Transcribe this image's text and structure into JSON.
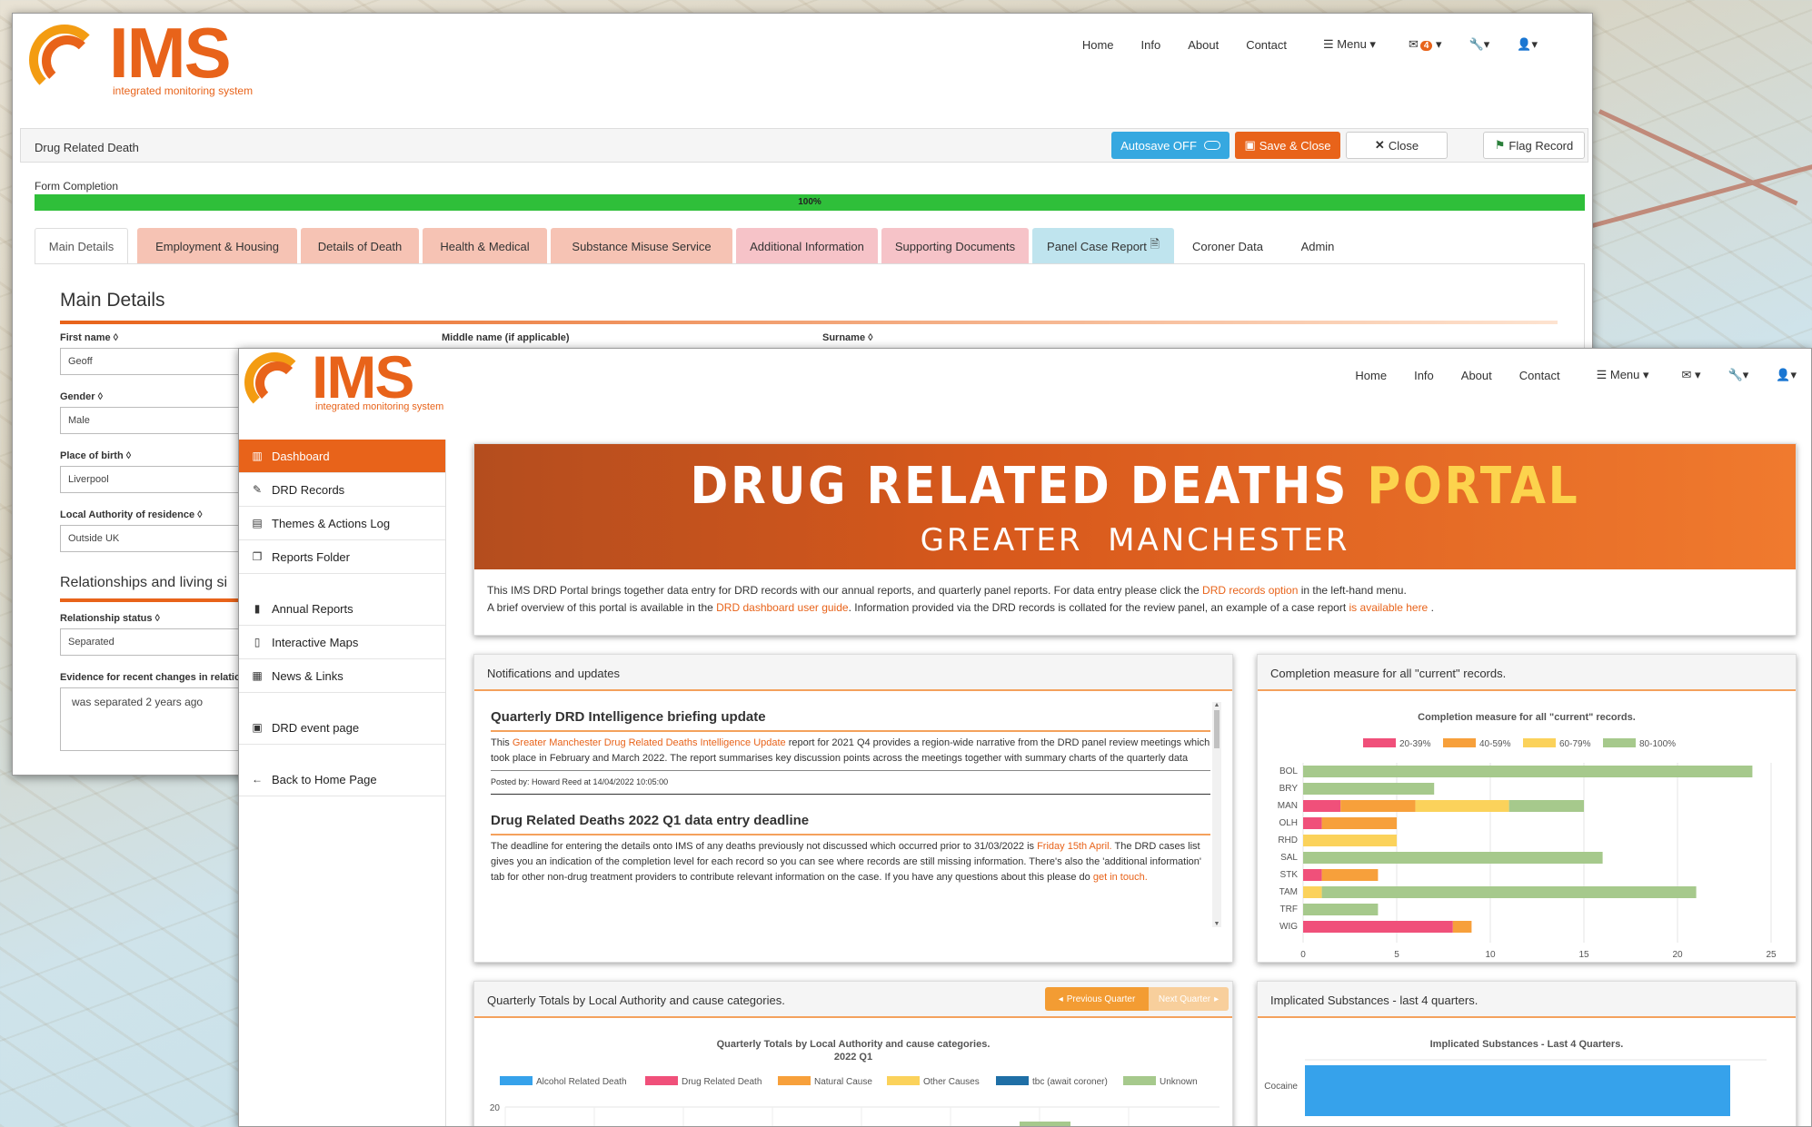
{
  "back_window": {
    "logo": {
      "title": "IMS",
      "subtitle": "integrated monitoring system"
    },
    "nav": [
      "Home",
      "Info",
      "About",
      "Contact",
      "Menu"
    ],
    "mail_count": "4",
    "form_title": "Drug Related Death",
    "autosave_label": "Autosave OFF",
    "save_label": "Save & Close",
    "close_label": "Close",
    "flag_label": "Flag Record",
    "completion_label": "Form Completion",
    "completion_value": "100%",
    "completion_percent": 100,
    "tabs": [
      "Main Details",
      "Employment & Housing",
      "Details of Death",
      "Health & Medical",
      "Substance Misuse Service",
      "Additional Information",
      "Supporting Documents",
      "Panel Case Report",
      "Coroner Data",
      "Admin"
    ],
    "section_title": "Main Details",
    "section2_title": "Relationships and living si",
    "fields": {
      "first_name_label": "First name ◊",
      "first_name": "Geoff",
      "middle_name_label": "Middle name (if applicable)",
      "surname_label": "Surname ◊",
      "gender_label": "Gender ◊",
      "gender": "Male",
      "pob_label": "Place of birth ◊",
      "pob": "Liverpool",
      "la_label": "Local Authority of residence ◊",
      "la": "Outside UK",
      "rel_label": "Relationship status ◊",
      "rel": "Separated",
      "evidence_label": "Evidence for recent changes in relatio",
      "evidence": "was separated 2 years ago"
    }
  },
  "front_window": {
    "logo": {
      "title": "IMS",
      "subtitle": "integrated monitoring system"
    },
    "nav": [
      "Home",
      "Info",
      "About",
      "Contact",
      "Menu"
    ],
    "sidebar": [
      {
        "label": "Dashboard",
        "icon": "chart-icon",
        "active": true
      },
      {
        "label": "DRD Records",
        "icon": "edit-icon"
      },
      {
        "label": "Themes & Actions Log",
        "icon": "clipboard-icon"
      },
      {
        "label": "Reports Folder",
        "icon": "copy-icon"
      },
      {
        "label": "Annual Reports",
        "icon": "book-icon"
      },
      {
        "label": "Interactive Maps",
        "icon": "map-icon"
      },
      {
        "label": "News & Links",
        "icon": "newspaper-icon"
      },
      {
        "label": "DRD event page",
        "icon": "calendar-icon"
      },
      {
        "label": "Back to Home Page",
        "icon": "arrow-left-icon"
      }
    ],
    "banner": {
      "title_white": "DRUG RELATED DEATHS",
      "title_yellow": "PORTAL",
      "subtitle": "GREATER  MANCHESTER"
    },
    "intro": {
      "l1a": "This IMS DRD Portal brings together data entry for DRD records with our annual reports, and quarterly panel reports. For data entry please click the ",
      "l1link": "DRD records option",
      "l1b": " in the left-hand menu.",
      "l2a": "A brief overview of this portal is available in the ",
      "l2link": "DRD dashboard user guide",
      "l2b": ". Information provided via the DRD records is collated for the review panel, an example of a case report ",
      "l2link2": "is available here",
      "l2c": " ."
    },
    "notifications": {
      "header": "Notifications and updates",
      "items": [
        {
          "title": "Quarterly DRD Intelligence briefing update",
          "a": "This ",
          "link": "Greater Manchester Drug Related Deaths Intelligence Update",
          "b": " report for 2021 Q4 provides a region-wide narrative from the DRD panel review meetings which took place in February and March 2022. The report summarises key discussion points across the meetings together with summary charts of the quarterly data",
          "posted": "Posted by: Howard Reed at 14/04/2022 10:05:00"
        },
        {
          "title": "Drug Related Deaths 2022 Q1 data entry deadline",
          "a": "The deadline for entering the details onto IMS of any deaths previously not discussed which occurred prior to 31/03/2022 is ",
          "link": "Friday 15th April.",
          "b": " The DRD cases list gives you an indication of the completion level for each record so you can see where records are still missing information. There's also the 'additional information' tab for other non-drug treatment providers to contribute relevant information on the case. If you have any questions about this please do ",
          "link2": "get in touch."
        }
      ]
    },
    "completion_panel": {
      "header": "Completion measure for all \"current\" records."
    },
    "quarterly_panel": {
      "header": "Quarterly Totals by Local Authority and cause categories.",
      "prev": "Previous Quarter",
      "next": "Next Quarter"
    },
    "substances_panel": {
      "header": "Implicated Substances - last 4 quarters."
    }
  },
  "chart_data": [
    {
      "type": "bar",
      "orientation": "horizontal",
      "stacked": true,
      "title": "Completion measure for all \"current\" records.",
      "categories": [
        "BOL",
        "BRY",
        "MAN",
        "OLH",
        "RHD",
        "SAL",
        "STK",
        "TAM",
        "TRF",
        "WIG"
      ],
      "series": [
        {
          "name": "20-39%",
          "color": "#f0507a",
          "values": [
            0,
            0,
            2,
            1,
            0,
            0,
            1,
            0,
            0,
            8
          ]
        },
        {
          "name": "40-59%",
          "color": "#f7a03b",
          "values": [
            0,
            0,
            4,
            4,
            0,
            0,
            3,
            0,
            0,
            1
          ]
        },
        {
          "name": "60-79%",
          "color": "#fbd25b",
          "values": [
            0,
            0,
            5,
            0,
            5,
            0,
            0,
            1,
            0,
            0
          ]
        },
        {
          "name": "80-100%",
          "color": "#a6c98c",
          "values": [
            24,
            7,
            4,
            0,
            0,
            16,
            0,
            20,
            4,
            0
          ]
        }
      ],
      "xlim": [
        0,
        25
      ],
      "xticks": [
        0,
        5,
        10,
        15,
        20,
        25
      ],
      "legend": "top"
    },
    {
      "type": "bar",
      "title": "Quarterly Totals by Local Authority and cause categories.",
      "subtitle": "2022 Q1",
      "series": [
        {
          "name": "Alcohol Related Death",
          "color": "#36a2eb"
        },
        {
          "name": "Drug Related Death",
          "color": "#f0507a"
        },
        {
          "name": "Natural Cause",
          "color": "#f7a03b"
        },
        {
          "name": "Other Causes",
          "color": "#fbd25b"
        },
        {
          "name": "tbc (await coroner)",
          "color": "#1f6fa6"
        },
        {
          "name": "Unknown",
          "color": "#a6c98c"
        }
      ],
      "yticks": [
        20,
        18
      ],
      "legend": "top"
    },
    {
      "type": "bar",
      "orientation": "horizontal",
      "title": "Implicated Substances - Last 4 Quarters.",
      "categories": [
        "Cocaine"
      ],
      "series": [
        {
          "name": "",
          "color": "#36a2eb"
        }
      ]
    }
  ],
  "colors": {
    "orange": "#e8631a",
    "green_progress": "#2fbf3a",
    "autosave": "#36a8e0",
    "save": "#e8631a"
  }
}
